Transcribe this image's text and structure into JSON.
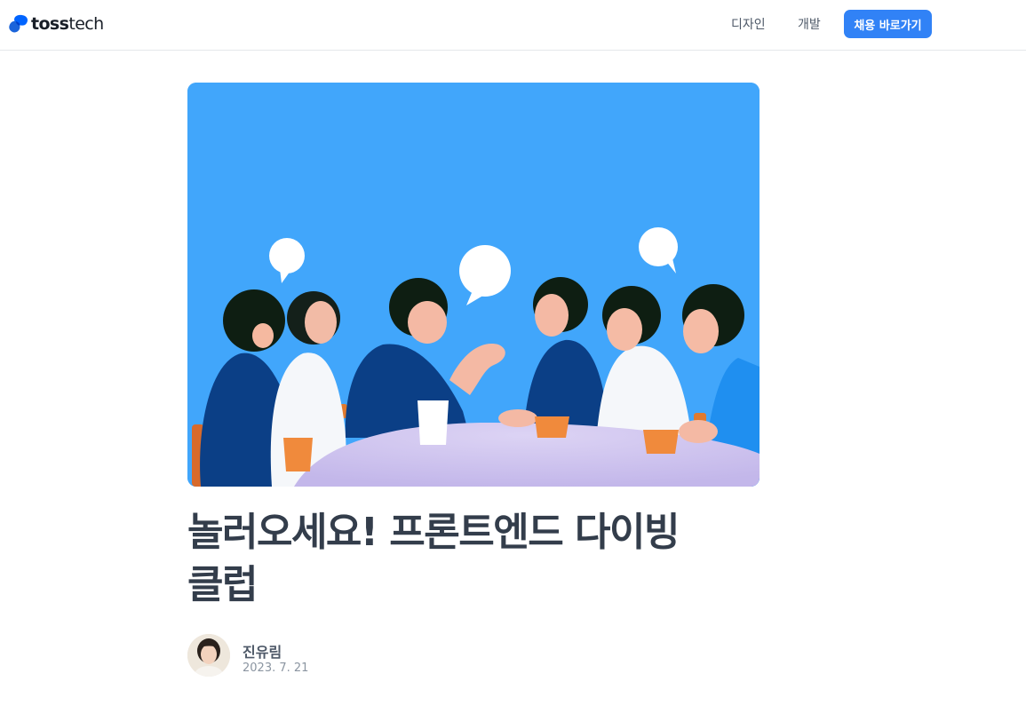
{
  "header": {
    "logo": {
      "bold": "toss",
      "light": "tech"
    },
    "nav": [
      {
        "label": "디자인"
      },
      {
        "label": "개발"
      }
    ],
    "recruit_button": "채용 바로가기"
  },
  "article": {
    "hero_image_alt": "사람들이 테이블에 둘러앉아 이야기하는 일러스트",
    "title": "놀러오세요! 프론트엔드 다이빙\n클럽",
    "author": {
      "name": "진유림",
      "date": "2023. 7. 21"
    }
  },
  "colors": {
    "accent": "#3182f6",
    "hero_background": "#41a6fb",
    "title_text": "#333d4b",
    "muted_text": "#8b95a1"
  }
}
